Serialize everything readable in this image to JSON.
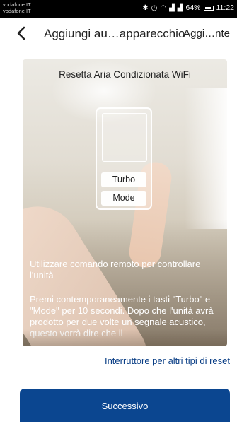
{
  "status_bar": {
    "carrier_1": "vodafone IT",
    "carrier_2": "vodafone IT",
    "battery": "64%",
    "time": "11:22"
  },
  "header": {
    "back_icon": "chevron-left-icon",
    "title": "Aggiungi au…apparecchio",
    "action": "Aggi…nte"
  },
  "card": {
    "title": "Resetta Aria Condizionata WiFi",
    "remote_buttons": [
      "Turbo",
      "Mode"
    ],
    "instruction_1": "Utilizzare comando remoto per controllare l'unità",
    "instruction_2": "Premi contemporaneamente i tasti \"Turbo\" e \"Mode\" per 10 secondi. Dopo che l'unità avrà prodotto per due volte un segnale acustico, questo vorrà dire che il"
  },
  "reset_link": "Interruttore per altri tipi di reset",
  "next_button": "Successivo",
  "colors": {
    "accent": "#0b4690",
    "link": "#0b3f86"
  }
}
